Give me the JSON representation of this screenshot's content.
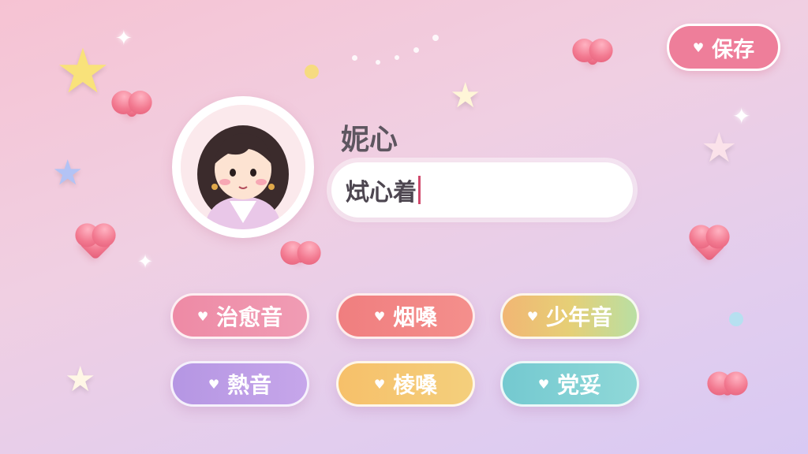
{
  "toolbar": {
    "save_label": "保存",
    "save_icon": "heart-icon"
  },
  "profile": {
    "name_label": "妮心",
    "name_input_value": "烒心着",
    "avatar_icon": "girl-avatar"
  },
  "voice_tags": [
    {
      "label": "治愈音",
      "color": "#ee8aa5"
    },
    {
      "label": "烟嗓",
      "color": "#f07e7f"
    },
    {
      "label": "少年音",
      "color": "#e8c070"
    },
    {
      "label": "熱音",
      "color": "#b898e3"
    },
    {
      "label": "棱嗓",
      "color": "#f4c46c"
    },
    {
      "label": "党妥",
      "color": "#7fcfd4"
    }
  ],
  "colors": {
    "accent_pink": "#ee7e9a",
    "caret": "#d0496c"
  }
}
